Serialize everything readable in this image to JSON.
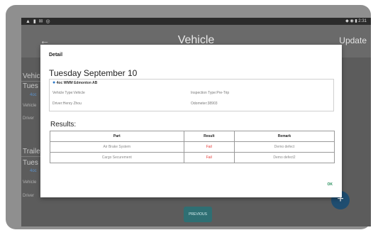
{
  "statusbar": {
    "left_icons": "▲ ▮ ✉ ◎",
    "right_text": "◆ ◉ ▮ 2:31"
  },
  "appbar": {
    "title": "Vehicle",
    "update_label": "Update",
    "back_glyph": "←"
  },
  "background": {
    "vehicle_section": "Vehic",
    "vehicle_date": "Tues",
    "vehicle_loc": "4oc",
    "vehicle_line1": "Vehicle",
    "vehicle_line2": "Driver",
    "trailer_section": "Traile",
    "trailer_date": "Tues",
    "trailer_loc": "4oc",
    "trailer_line1": "Vehicle",
    "trailer_line2": "Driver",
    "previous_label": "PREVIOUS",
    "fab_glyph": "+"
  },
  "dialog": {
    "header": "Detail",
    "date": "Tuesday September 10",
    "location": "4oc WMM Edmonton AB",
    "vehicle_type": "Vehicle Type:Vehicle",
    "inspection_type": "Inspection Type:Pre-Trip",
    "driver": "Driver:Henry Zhou",
    "odometer": "Odometer:38903",
    "results_label": "Results:",
    "table_headers": [
      "Part",
      "Result",
      "Remark"
    ],
    "rows": [
      {
        "part": "Air Brake System",
        "result": "Fail",
        "remark": "Demo defect"
      },
      {
        "part": "Cargo Securement",
        "result": "Fail",
        "remark": "Demo defect2"
      }
    ],
    "ok_label": "OK"
  },
  "colors": {
    "fail": "#e53935",
    "ok": "#1e8a55",
    "pin": "#2c78c8",
    "fab": "#1f4d70"
  }
}
